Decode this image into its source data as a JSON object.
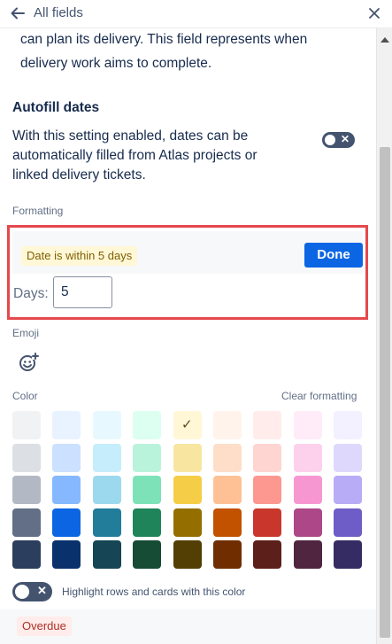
{
  "header": {
    "title": "All fields",
    "back_icon": "arrow-left-icon",
    "close_icon": "close-icon"
  },
  "description": {
    "line1": "can plan its delivery. This field represents when",
    "line2": "delivery work aims to complete."
  },
  "autofill": {
    "title": "Autofill dates",
    "text": "With this setting enabled, dates can be automatically filled from Atlas projects or linked delivery tickets.",
    "toggle_on": false
  },
  "formatting": {
    "label": "Formatting",
    "rule_chip": "Date is within 5 days",
    "done_label": "Done",
    "days_label": "Days:",
    "days_value": "5"
  },
  "emoji": {
    "label": "Emoji",
    "icon": "add-emoji-icon"
  },
  "color": {
    "label": "Color",
    "clear_label": "Clear formatting",
    "selected": "#fff7d6",
    "rows": [
      [
        "#f1f2f4",
        "#e9f2ff",
        "#e7f9ff",
        "#dcfff1",
        "#fff7d6",
        "#fff3eb",
        "#ffeceb",
        "#ffecf8",
        "#f3f0ff"
      ],
      [
        "#dcdfe4",
        "#cce0ff",
        "#c6edfb",
        "#baf3db",
        "#f8e6a0",
        "#fedec8",
        "#ffd5d2",
        "#fdd0ec",
        "#dfd8fd"
      ],
      [
        "#b3b9c4",
        "#85b8ff",
        "#9dd9ee",
        "#7ee2b8",
        "#f5cd47",
        "#fec195",
        "#fd9891",
        "#f797d2",
        "#b8acf6"
      ],
      [
        "#626f86",
        "#0c66e4",
        "#227d9b",
        "#1f845a",
        "#946f00",
        "#c25100",
        "#c9372c",
        "#ae4787",
        "#6e5dc6"
      ],
      [
        "#2c3e5d",
        "#09326c",
        "#164555",
        "#164b35",
        "#533f04",
        "#702e00",
        "#5d1f1a",
        "#50253f",
        "#352c63"
      ]
    ]
  },
  "highlight": {
    "text": "Highlight rows and cards with this color",
    "toggle_on": false
  },
  "overdue": {
    "chip": "Overdue"
  }
}
